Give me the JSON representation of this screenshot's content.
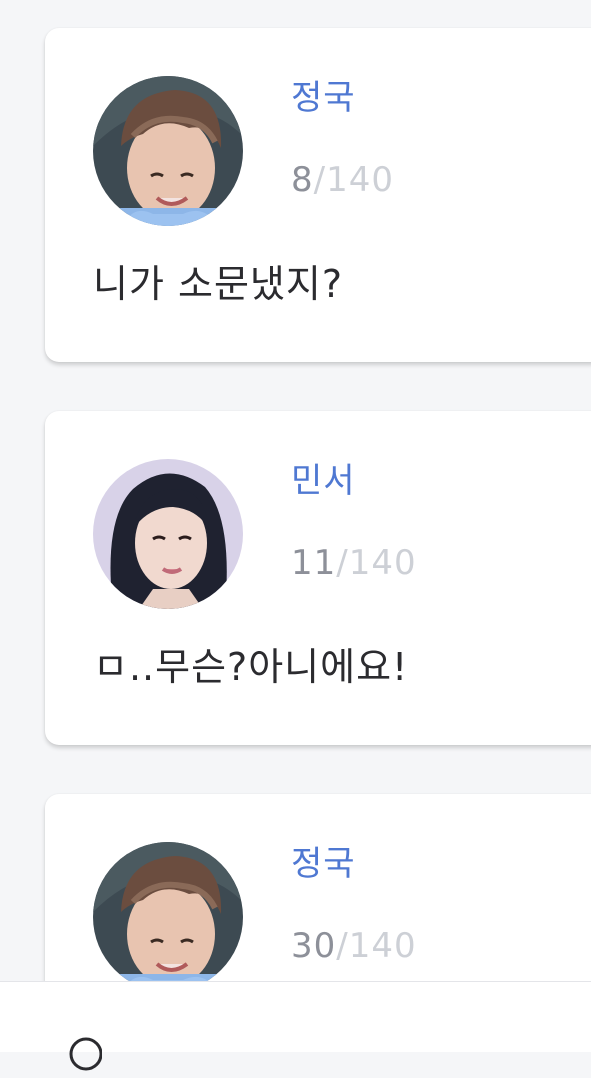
{
  "feed": {
    "posts": [
      {
        "author": "정국",
        "char_count": "8",
        "separator": "/",
        "char_limit": "140",
        "message": "니가 소문냈지?",
        "avatar_icon": "profile-photo-icon"
      },
      {
        "author": "민서",
        "char_count": "11",
        "separator": "/",
        "char_limit": "140",
        "message": "ㅁ..무슨?아니에요!",
        "avatar_icon": "profile-photo-icon"
      },
      {
        "author": "정국",
        "char_count": "30",
        "separator": "/",
        "char_limit": "140",
        "message": "",
        "avatar_icon": "profile-photo-icon"
      }
    ]
  },
  "bottom_bar": {
    "search_icon": "search-icon"
  },
  "colors": {
    "background": "#f5f6f8",
    "card": "#ffffff",
    "author_name": "#4f78d2",
    "count_current": "#8d9099",
    "count_limit": "#cdd0d6",
    "message_text": "#2b2b2f"
  }
}
